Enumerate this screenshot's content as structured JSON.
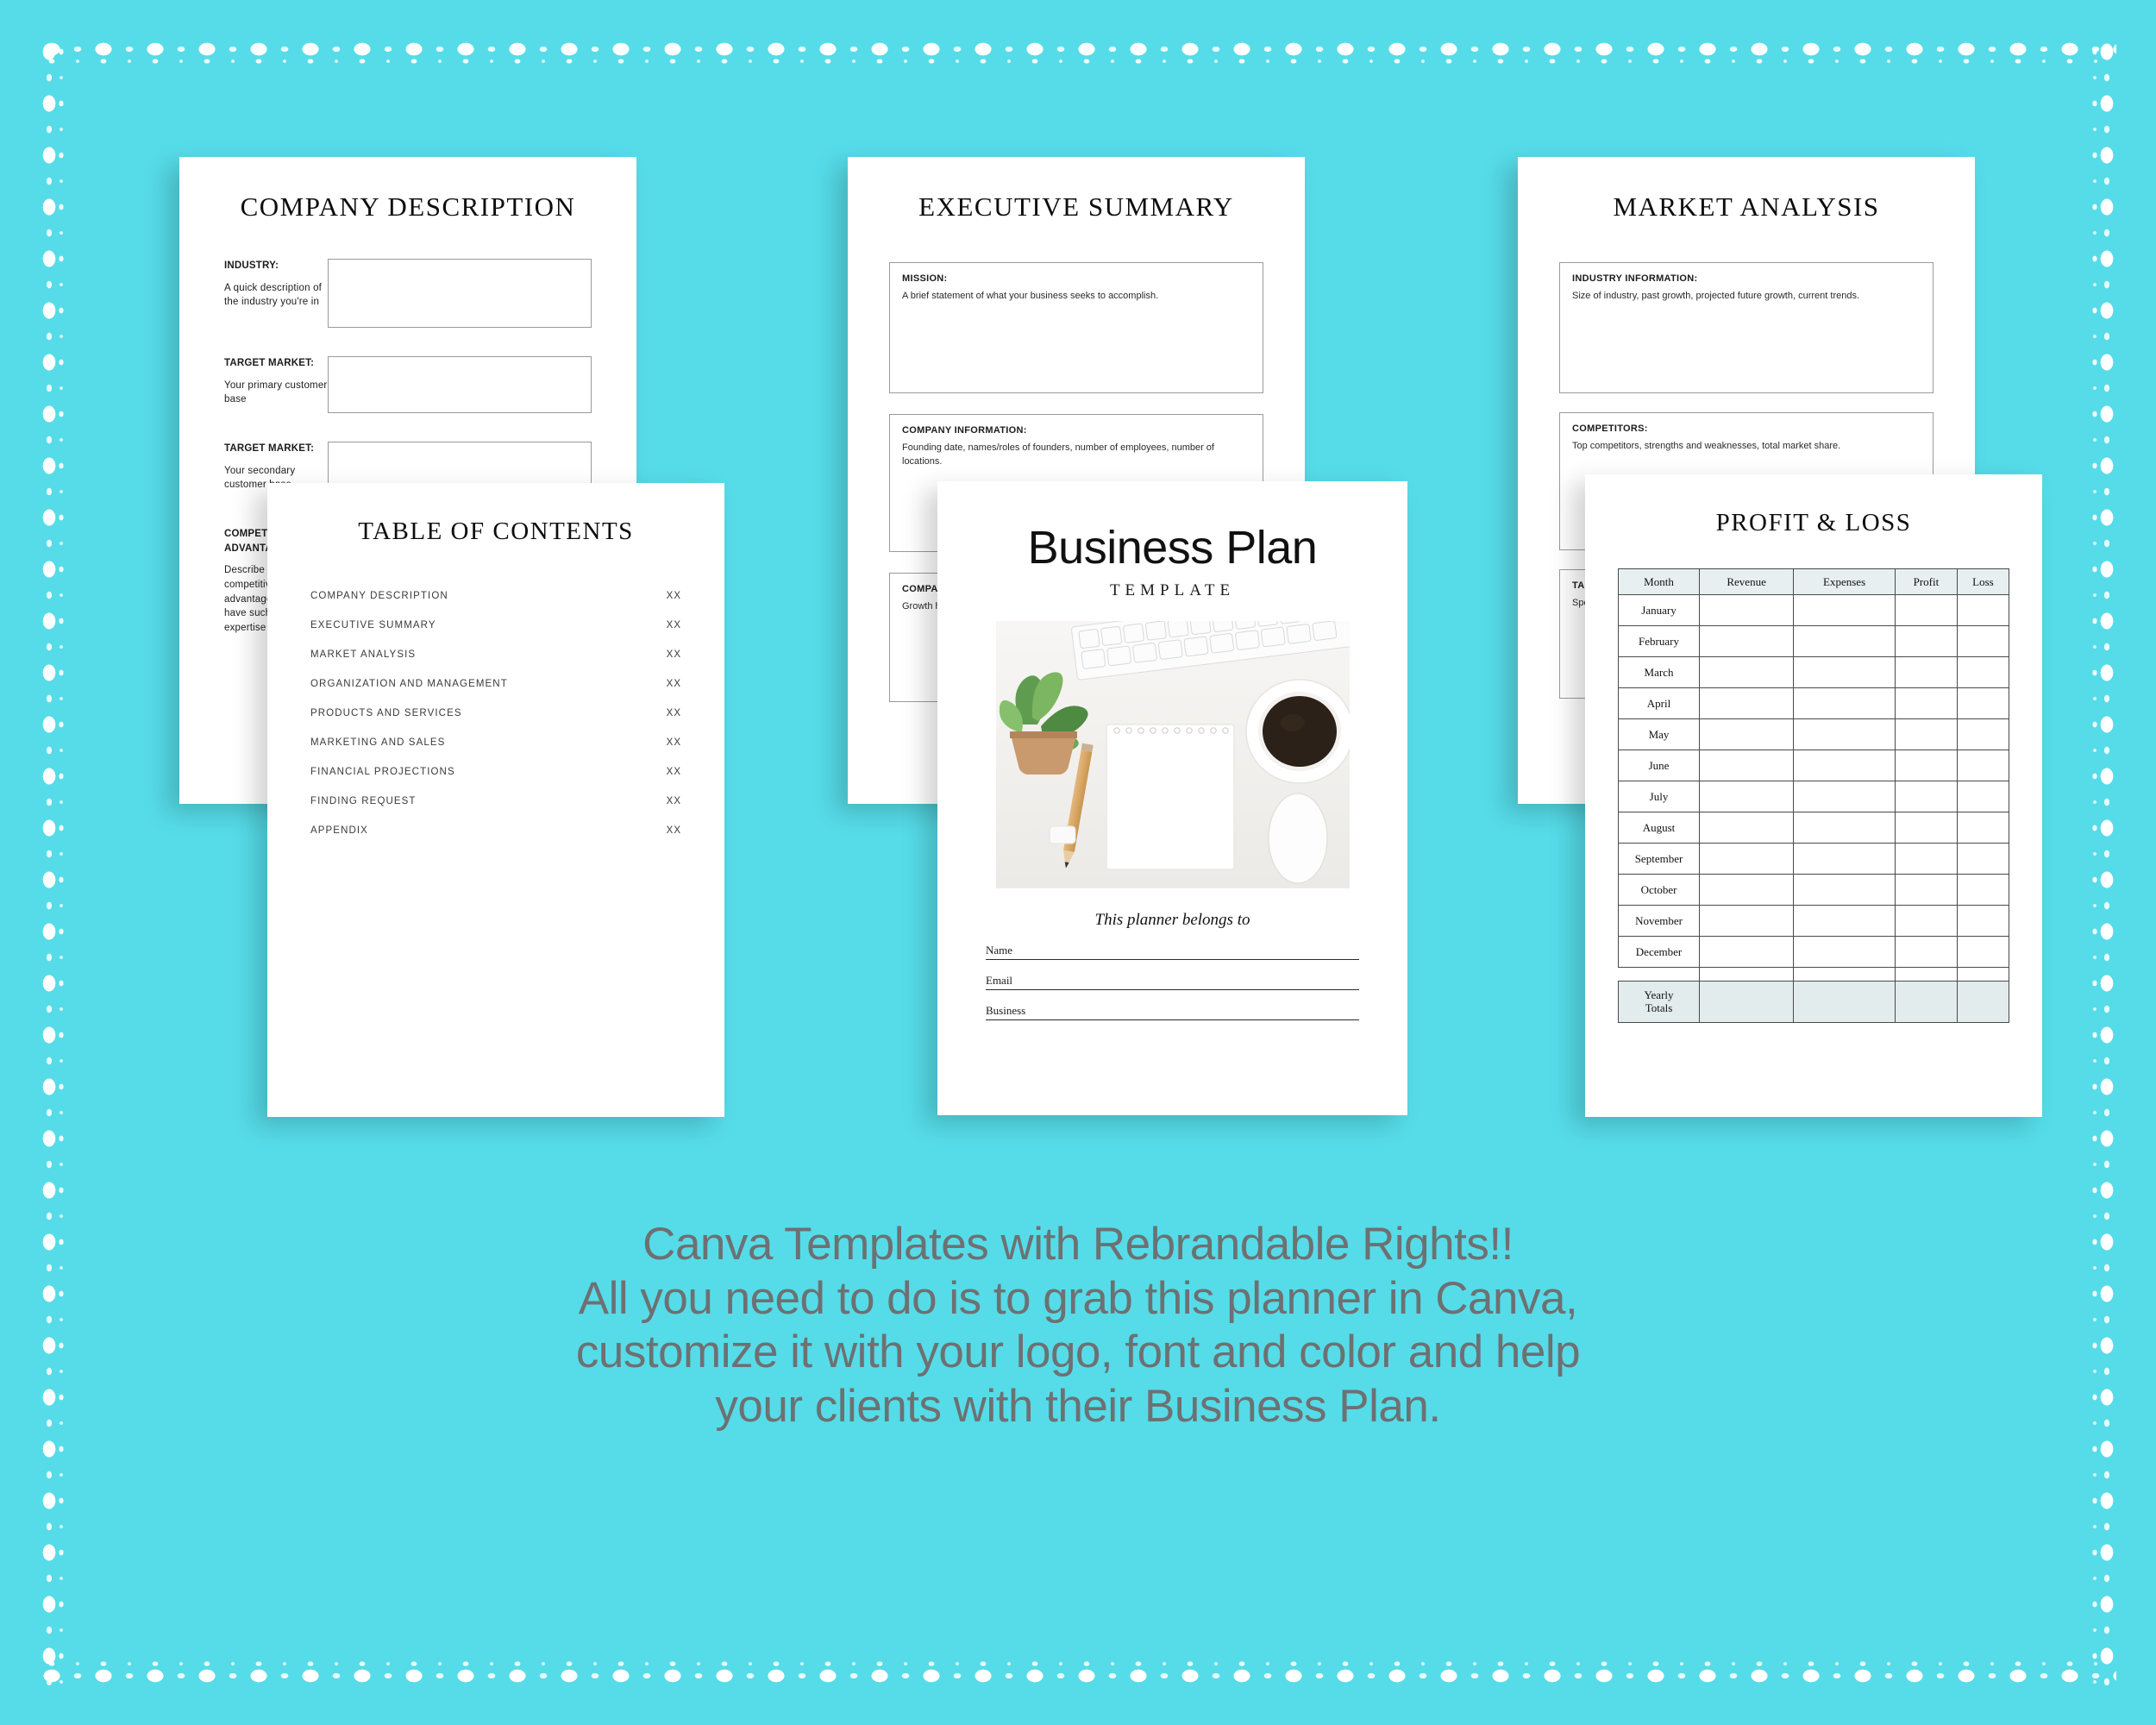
{
  "background_color": "#55dce8",
  "border": {
    "style": "dotted-white-frame",
    "color": "#ffffff"
  },
  "pages": {
    "company_description": {
      "title": "COMPANY DESCRIPTION",
      "fields": [
        {
          "label": "INDUSTRY:",
          "hint": "A quick description of the industry you're in"
        },
        {
          "label": "TARGET MARKET:",
          "hint": "Your primary customer base"
        },
        {
          "label": "TARGET MARKET:",
          "hint": "Your secondary customer base"
        },
        {
          "label": "COMPETITIVE ADVANTAGE:",
          "hint": "Describe any competitive advantages you may have such as expertise or location"
        }
      ]
    },
    "table_of_contents": {
      "title": "TABLE OF CONTENTS",
      "items": [
        {
          "label": "COMPANY DESCRIPTION",
          "page": "XX"
        },
        {
          "label": "EXECUTIVE SUMMARY",
          "page": "XX"
        },
        {
          "label": "MARKET ANALYSIS",
          "page": "XX"
        },
        {
          "label": "ORGANIZATION AND MANAGEMENT",
          "page": "XX"
        },
        {
          "label": "PRODUCTS AND SERVICES",
          "page": "XX"
        },
        {
          "label": "MARKETING AND SALES",
          "page": "XX"
        },
        {
          "label": "FINANCIAL PROJECTIONS",
          "page": "XX"
        },
        {
          "label": "FINDING REQUEST",
          "page": "XX"
        },
        {
          "label": "APPENDIX",
          "page": "XX"
        }
      ]
    },
    "executive_summary": {
      "title": "EXECUTIVE SUMMARY",
      "boxes": [
        {
          "label": "MISSION:",
          "body": "A brief statement of what your business seeks to accomplish."
        },
        {
          "label": "COMPANY INFORMATION:",
          "body": "Founding date, names/roles of founders, number of employees, number of locations."
        },
        {
          "label": "COMPANY HIGHLIGHTS:",
          "body": "Growth highlights with hard numbers."
        }
      ]
    },
    "market_analysis": {
      "title": "MARKET ANALYSIS",
      "boxes": [
        {
          "label": "INDUSTRY INFORMATION:",
          "body": "Size of industry, past growth, projected future growth, current trends."
        },
        {
          "label": "COMPETITORS:",
          "body": "Top competitors, strengths and weaknesses, total market share."
        },
        {
          "label": "TARGET MARKET:",
          "body": "Specific needs and solutions."
        }
      ]
    },
    "business_plan_cover": {
      "title": "Business Plan",
      "subtitle": "TEMPLATE",
      "belongs_to": "This planner belongs to",
      "fields": [
        "Name",
        "Email",
        "Business"
      ],
      "photo_alt": "flat-lay-desk-photo"
    },
    "profit_loss": {
      "title": "PROFIT & LOSS",
      "columns": [
        "Month",
        "Revenue",
        "Expenses",
        "Profit",
        "Loss"
      ],
      "rows": [
        "January",
        "February",
        "March",
        "April",
        "May",
        "June",
        "July",
        "August",
        "September",
        "October",
        "November",
        "December"
      ],
      "totals_label_line1": "Yearly",
      "totals_label_line2": "Totals",
      "header_fill": "#e7eff0",
      "totals_fill": "#e2ecec"
    }
  },
  "caption": {
    "color": "#6e7072",
    "line1": "Canva Templates with Rebrandable Rights!!",
    "line2": "All you need to do is to grab this planner in Canva,",
    "line3": "customize it with your logo, font and color and help",
    "line4": "your clients with their Business Plan."
  }
}
